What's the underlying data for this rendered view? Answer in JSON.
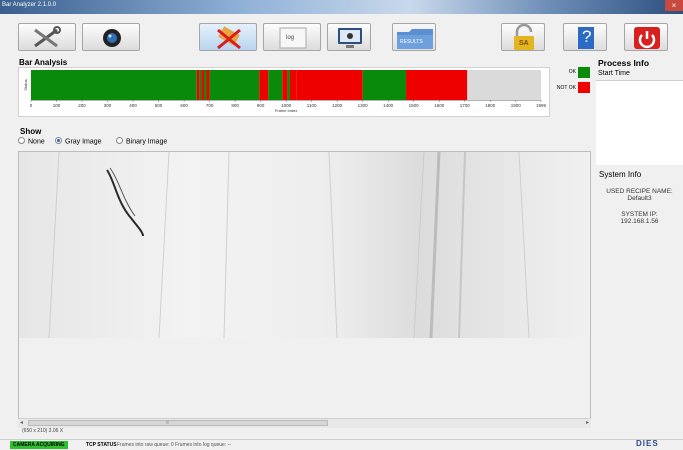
{
  "window": {
    "title": "Bar Analyzer 2.1.0.0",
    "close_glyph": "×"
  },
  "toolbar": {
    "buttons": [
      {
        "name": "settings-button",
        "icon": "tools-icon"
      },
      {
        "name": "camera-button",
        "icon": "camera-icon"
      },
      {
        "name": "clear-button",
        "icon": "brush-cross-icon"
      },
      {
        "name": "log-button",
        "icon": "log-icon",
        "label": "log"
      },
      {
        "name": "monitor-button",
        "icon": "monitor-icon"
      },
      {
        "name": "results-button",
        "icon": "folder-icon",
        "label": "RESULTS"
      },
      {
        "name": "lock-button",
        "icon": "padlock-icon",
        "label": "SA"
      },
      {
        "name": "help-button",
        "icon": "help-icon",
        "label": "?"
      },
      {
        "name": "power-button",
        "icon": "power-icon"
      }
    ]
  },
  "bar_analysis": {
    "title": "Bar Analysis",
    "legend": {
      "ok": "OK",
      "not_ok": "NOT OK"
    },
    "y_label": "Status"
  },
  "chart_data": {
    "type": "bar",
    "title": "Bar Analysis",
    "xlabel": "Frame Index",
    "ylabel": "Status",
    "xlim": [
      0,
      1999
    ],
    "xticks": [
      0,
      100,
      200,
      300,
      400,
      500,
      600,
      700,
      800,
      900,
      1000,
      1100,
      1200,
      1300,
      1400,
      1500,
      1600,
      1700,
      1800,
      1900,
      1999
    ],
    "segments": [
      {
        "start": 0,
        "end": 650,
        "status": "OK"
      },
      {
        "start": 650,
        "end": 660,
        "status": "NOT OK"
      },
      {
        "start": 660,
        "end": 668,
        "status": "OK"
      },
      {
        "start": 668,
        "end": 678,
        "status": "NOT OK"
      },
      {
        "start": 678,
        "end": 688,
        "status": "OK"
      },
      {
        "start": 688,
        "end": 700,
        "status": "NOT OK"
      },
      {
        "start": 700,
        "end": 895,
        "status": "OK"
      },
      {
        "start": 895,
        "end": 930,
        "status": "NOT OK"
      },
      {
        "start": 930,
        "end": 985,
        "status": "OK"
      },
      {
        "start": 985,
        "end": 1005,
        "status": "NOT OK"
      },
      {
        "start": 1005,
        "end": 1015,
        "status": "OK"
      },
      {
        "start": 1015,
        "end": 1040,
        "status": "NOT OK"
      },
      {
        "start": 1040,
        "end": 1300,
        "status": "NOT OK"
      },
      {
        "start": 1300,
        "end": 1470,
        "status": "OK"
      },
      {
        "start": 1470,
        "end": 1710,
        "status": "NOT OK"
      },
      {
        "start": 1710,
        "end": 1999,
        "status": "NONE"
      }
    ],
    "colors": {
      "OK": "#0a8a0a",
      "NOT OK": "#ee0000",
      "NONE": "#dadada"
    },
    "grid": false,
    "legend_position": "right"
  },
  "show": {
    "title": "Show",
    "options": [
      {
        "label": "None",
        "selected": false
      },
      {
        "label": "Gray Image",
        "selected": true
      },
      {
        "label": "Binary Image",
        "selected": false
      }
    ]
  },
  "viewer": {
    "info": "(650 x 210)  3.06 X",
    "scroll_glyph_left": "◂",
    "scroll_glyph_right": "▸",
    "scroll_grip": "|||"
  },
  "process_info": {
    "title": "Process Info",
    "start_time_label": "Start Time"
  },
  "system_info": {
    "title": "System Info",
    "recipe_label": "USED RECIPE NAME:",
    "recipe_value": "Default3",
    "ip_label": "SYSTEM IP:",
    "ip_value": "192.168.1.56"
  },
  "status_bar": {
    "camera": "CAMERA ACQUIRING",
    "tcp": "TCP STATUS",
    "message": "Frames into raw queue: 0   Frames into log queue: --",
    "brand": "DIES"
  }
}
